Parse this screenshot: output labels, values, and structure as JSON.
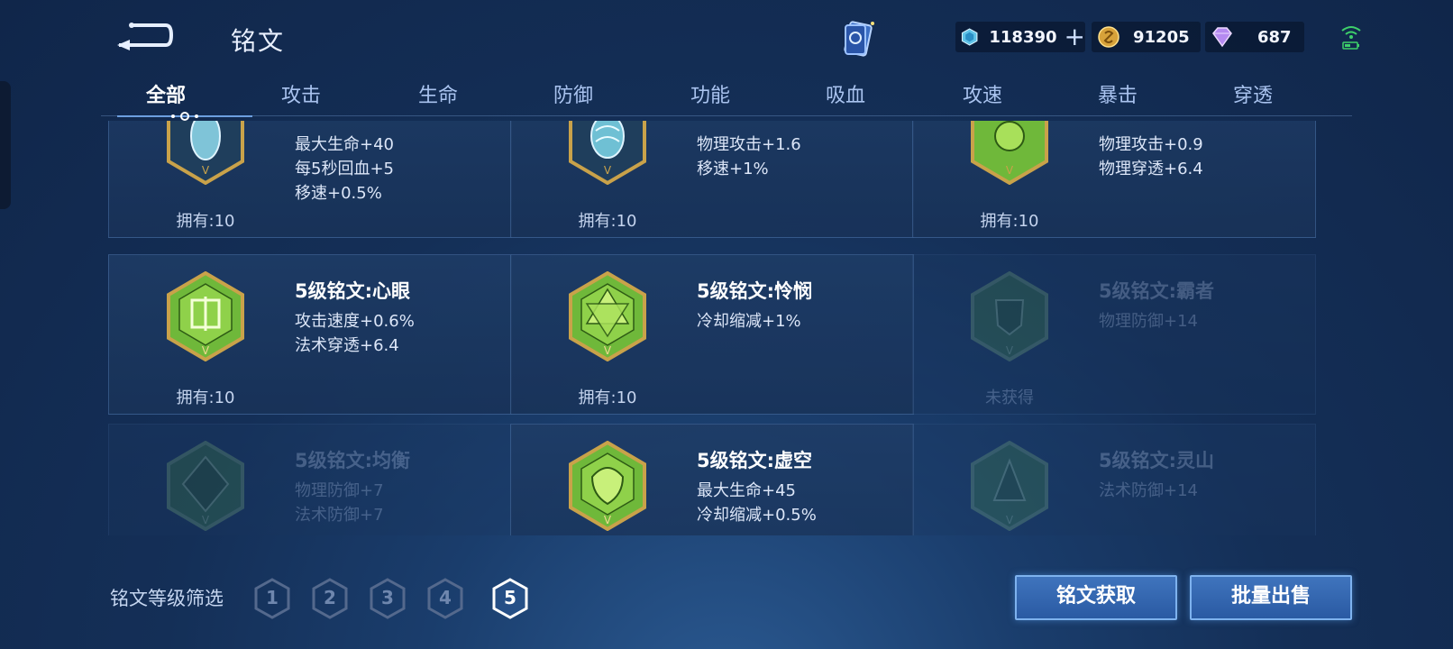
{
  "header": {
    "title": "铭文"
  },
  "currencies": {
    "gem": "118390",
    "coin": "91205",
    "diamond": "687"
  },
  "tabs": [
    "全部",
    "攻击",
    "生命",
    "防御",
    "功能",
    "吸血",
    "攻速",
    "暴击",
    "穿透"
  ],
  "cards": [
    {
      "name": "",
      "stats": [
        "最大生命+40",
        "每5秒回血+5",
        "移速+0.5%"
      ],
      "owned": "拥有:10"
    },
    {
      "name": "",
      "stats": [
        "物理攻击+1.6",
        "移速+1%"
      ],
      "owned": "拥有:10"
    },
    {
      "name": "",
      "stats": [
        "物理攻击+0.9",
        "物理穿透+6.4"
      ],
      "owned": "拥有:10"
    },
    {
      "name": "5级铭文:心眼",
      "stats": [
        "攻击速度+0.6%",
        "法术穿透+6.4"
      ],
      "owned": "拥有:10"
    },
    {
      "name": "5级铭文:怜悯",
      "stats": [
        "冷却缩减+1%"
      ],
      "owned": "拥有:10"
    },
    {
      "name": "5级铭文:霸者",
      "stats": [
        "物理防御+14"
      ],
      "owned": "未获得"
    },
    {
      "name": "5级铭文:均衡",
      "stats": [
        "物理防御+7",
        "法术防御+7"
      ],
      "owned": ""
    },
    {
      "name": "5级铭文:虚空",
      "stats": [
        "最大生命+45",
        "冷却缩减+0.5%"
      ],
      "owned": ""
    },
    {
      "name": "5级铭文:灵山",
      "stats": [
        "法术防御+14"
      ],
      "owned": ""
    }
  ],
  "filter": {
    "label": "铭文等级筛选",
    "levels": [
      "1",
      "2",
      "3",
      "4",
      "5"
    ],
    "selected": "5"
  },
  "buttons": {
    "acquire": "铭文获取",
    "sell": "批量出售"
  },
  "colors": {
    "accent": "#3f74bd",
    "badge_green": "#6fb83a",
    "badge_gold": "#c9a24a",
    "badge_blue": "#7fc4d8"
  }
}
